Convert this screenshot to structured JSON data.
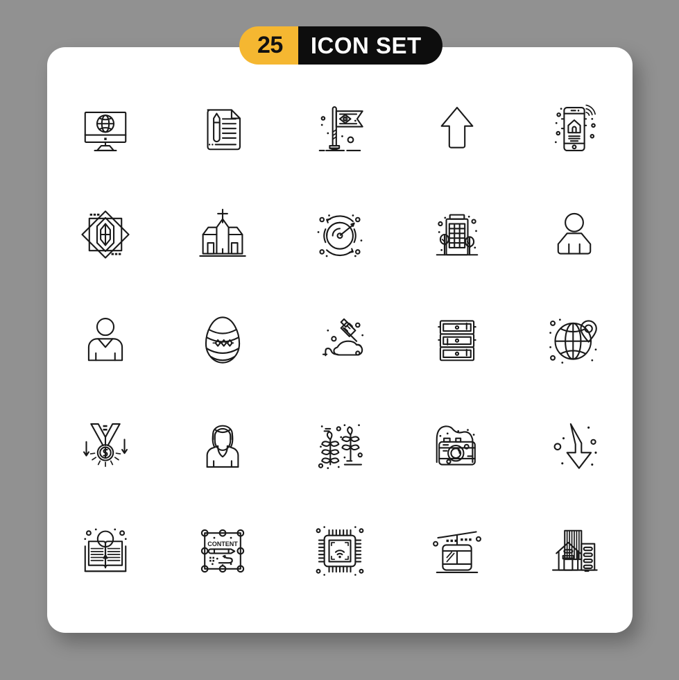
{
  "page": {
    "background_color": "#919191",
    "card_color": "#ffffff"
  },
  "header": {
    "count": "25",
    "title": "ICON SET",
    "count_bg_color": "#F5B731",
    "count_text_color": "#111111",
    "title_bg_color": "#0d0d0d",
    "title_text_color": "#ffffff"
  },
  "grid": {
    "columns": 5,
    "rows": 5,
    "total_icons": 25,
    "stroke_color": "#1a1a1a"
  },
  "icons": [
    {
      "index": 1,
      "name": "desktop-globe-icon",
      "label": "Desktop monitor with globe"
    },
    {
      "index": 2,
      "name": "document-pencil-icon",
      "label": "Document with pencil"
    },
    {
      "index": 3,
      "name": "flag-eye-icon",
      "label": "Flag with eye emblem"
    },
    {
      "index": 4,
      "name": "arrow-up-icon",
      "label": "Upward arrow"
    },
    {
      "index": 5,
      "name": "smartphone-smart-home-icon",
      "label": "Smartphone smart home wifi"
    },
    {
      "index": 6,
      "name": "diamond-gem-icon",
      "label": "Diamond gem in geometric frame"
    },
    {
      "index": 7,
      "name": "church-icon",
      "label": "Church building"
    },
    {
      "index": 8,
      "name": "radar-orbit-icon",
      "label": "Radar orbit scanner"
    },
    {
      "index": 9,
      "name": "office-building-trees-icon",
      "label": "Office building with trees"
    },
    {
      "index": 10,
      "name": "user-avatar-icon",
      "label": "User avatar"
    },
    {
      "index": 11,
      "name": "person-vneck-icon",
      "label": "Person wearing v-neck"
    },
    {
      "index": 12,
      "name": "easter-egg-icon",
      "label": "Decorated easter egg"
    },
    {
      "index": 13,
      "name": "lab-mouse-syringe-icon",
      "label": "Laboratory mouse with syringe"
    },
    {
      "index": 14,
      "name": "server-rack-icon",
      "label": "Server rack"
    },
    {
      "index": 15,
      "name": "globe-location-pin-icon",
      "label": "Globe with location pin"
    },
    {
      "index": 16,
      "name": "dollar-medal-icon",
      "label": "Dollar medal with down arrows"
    },
    {
      "index": 17,
      "name": "woman-avatar-icon",
      "label": "Woman avatar"
    },
    {
      "index": 18,
      "name": "plants-crops-icon",
      "label": "Growing plants crops"
    },
    {
      "index": 19,
      "name": "camera-icon",
      "label": "Photo camera"
    },
    {
      "index": 20,
      "name": "down-arrow-swoosh-icon",
      "label": "Downward swoosh arrow"
    },
    {
      "index": 21,
      "name": "book-search-icon",
      "label": "Open book with magnifier"
    },
    {
      "index": 22,
      "name": "content-editor-icon",
      "label": "Content editor selection box",
      "text": "CONTENT"
    },
    {
      "index": 23,
      "name": "cpu-wifi-chip-icon",
      "label": "CPU chip with wifi"
    },
    {
      "index": 24,
      "name": "cable-car-icon",
      "label": "Cable car gondola"
    },
    {
      "index": 25,
      "name": "house-buildings-icon",
      "label": "House with office buildings"
    }
  ]
}
